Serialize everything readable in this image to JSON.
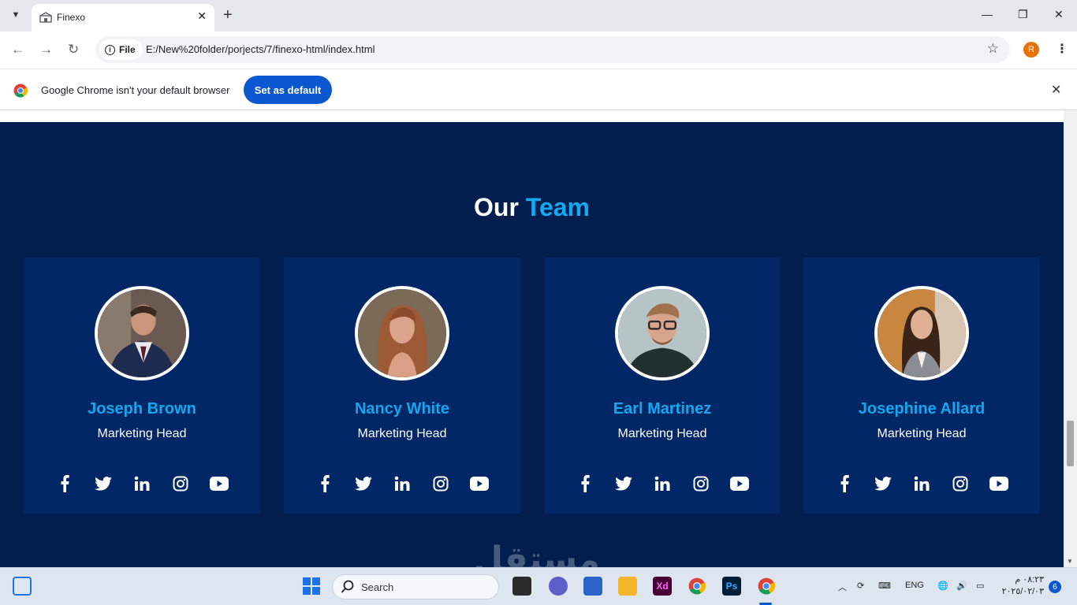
{
  "browser": {
    "tab_title": "Finexo",
    "url_scheme_label": "File",
    "url": "E:/New%20folder/porjects/7/finexo-html/index.html",
    "profile_initial": "R"
  },
  "infobar": {
    "message": "Google Chrome isn't your default browser",
    "button_label": "Set as default"
  },
  "page": {
    "heading_main": "Our",
    "heading_accent": "Team",
    "accent_color": "#11aaf0",
    "section_bg": "#011e4e",
    "card_bg": "#022766",
    "team": [
      {
        "name": "Joseph Brown",
        "role": "Marketing Head",
        "photo": "man-in-suit-portrait"
      },
      {
        "name": "Nancy White",
        "role": "Marketing Head",
        "photo": "woman-long-hair-portrait"
      },
      {
        "name": "Earl Martinez",
        "role": "Marketing Head",
        "photo": "man-with-glasses-portrait"
      },
      {
        "name": "Josephine Allard",
        "role": "Marketing Head",
        "photo": "woman-smiling-portrait"
      }
    ],
    "social_icons": [
      "facebook-icon",
      "twitter-icon",
      "linkedin-icon",
      "instagram-icon",
      "youtube-icon"
    ],
    "watermark": "مستقل"
  },
  "taskbar": {
    "search_placeholder": "Search",
    "language": "ENG",
    "time": "٠٨:٢٣ م",
    "date": "٢٠٢٥/٠٢/٠٣",
    "notification_count": "6"
  }
}
